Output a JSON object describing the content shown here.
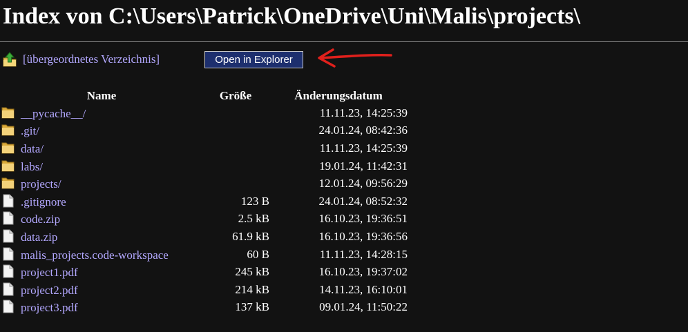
{
  "page": {
    "title": "Index von C:\\Users\\Patrick\\OneDrive\\Uni\\Malis\\projects\\",
    "parent_link": "[übergeordnetes Verzeichnis]",
    "explorer_button": "Open in Explorer",
    "annotation_color": "#e0201c",
    "link_color": "#b3a8ff",
    "background_color": "#121212"
  },
  "table": {
    "headers": {
      "name": "Name",
      "size": "Größe",
      "modified": "Änderungsdatum"
    },
    "rows": [
      {
        "type": "folder",
        "name": "__pycache__/",
        "size": "",
        "modified": "11.11.23, 14:25:39"
      },
      {
        "type": "folder",
        "name": ".git/",
        "size": "",
        "modified": "24.01.24, 08:42:36"
      },
      {
        "type": "folder",
        "name": "data/",
        "size": "",
        "modified": "11.11.23, 14:25:39"
      },
      {
        "type": "folder",
        "name": "labs/",
        "size": "",
        "modified": "19.01.24, 11:42:31"
      },
      {
        "type": "folder",
        "name": "projects/",
        "size": "",
        "modified": "12.01.24, 09:56:29"
      },
      {
        "type": "file",
        "name": ".gitignore",
        "size": "123 B",
        "modified": "24.01.24, 08:52:32"
      },
      {
        "type": "file",
        "name": "code.zip",
        "size": "2.5 kB",
        "modified": "16.10.23, 19:36:51"
      },
      {
        "type": "file",
        "name": "data.zip",
        "size": "61.9 kB",
        "modified": "16.10.23, 19:36:56"
      },
      {
        "type": "file",
        "name": "malis_projects.code-workspace",
        "size": "60 B",
        "modified": "11.11.23, 14:28:15"
      },
      {
        "type": "file",
        "name": "project1.pdf",
        "size": "245 kB",
        "modified": "16.10.23, 19:37:02"
      },
      {
        "type": "file",
        "name": "project2.pdf",
        "size": "214 kB",
        "modified": "14.11.23, 16:10:01"
      },
      {
        "type": "file",
        "name": "project3.pdf",
        "size": "137 kB",
        "modified": "09.01.24, 11:50:22"
      }
    ]
  }
}
